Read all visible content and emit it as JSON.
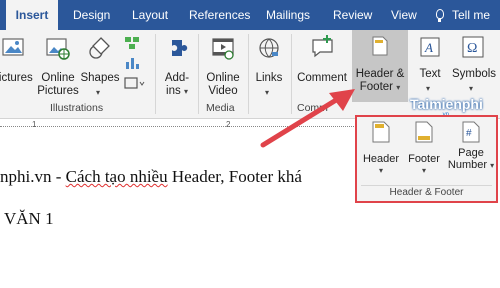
{
  "tabs": [
    {
      "label": "Insert",
      "active": true
    },
    {
      "label": "Design"
    },
    {
      "label": "Layout"
    },
    {
      "label": "References"
    },
    {
      "label": "Mailings"
    },
    {
      "label": "Review"
    },
    {
      "label": "View"
    },
    {
      "label": "Tell me"
    }
  ],
  "ribbon": {
    "pictures": "Pictures",
    "online_pictures_1": "Online",
    "online_pictures_2": "Pictures",
    "shapes": "Shapes",
    "illustrations_group": "Illustrations",
    "addins_1": "Add-",
    "addins_2": "ins",
    "online_video_1": "Online",
    "online_video_2": "Video",
    "media_group": "Media",
    "links": "Links",
    "comment": "Comment",
    "comments_group": "Comm",
    "header_footer_1": "Header &",
    "header_footer_2": "Footer",
    "text": "Text",
    "symbols": "Symbols"
  },
  "ruler": {
    "num1": "1",
    "num2": "2"
  },
  "document": {
    "line1_prefix": "nphi.vn - ",
    "line1_squiggle": "Cách tạo nhiều",
    "line1_rest": " Header, Footer khá",
    "line2": "VĂN 1"
  },
  "dropdown": {
    "header": "Header",
    "footer": "Footer",
    "page_number_1": "Page",
    "page_number_2": "Number",
    "group": "Header & Footer"
  },
  "watermark": {
    "text": "Taimienphi",
    "suffix": ".vn"
  },
  "colors": {
    "accent": "#2b579a",
    "highlight_border": "#e0434a",
    "arrow": "#e0434a"
  },
  "icons": [
    "pictures-icon",
    "online-pictures-icon",
    "shapes-icon",
    "smartart-icon",
    "chart-icon",
    "screenshot-icon",
    "addins-icon",
    "online-video-icon",
    "links-icon",
    "comment-icon",
    "header-footer-icon",
    "text-icon",
    "symbols-icon",
    "lightbulb-icon",
    "header-icon",
    "footer-icon",
    "page-number-icon"
  ]
}
